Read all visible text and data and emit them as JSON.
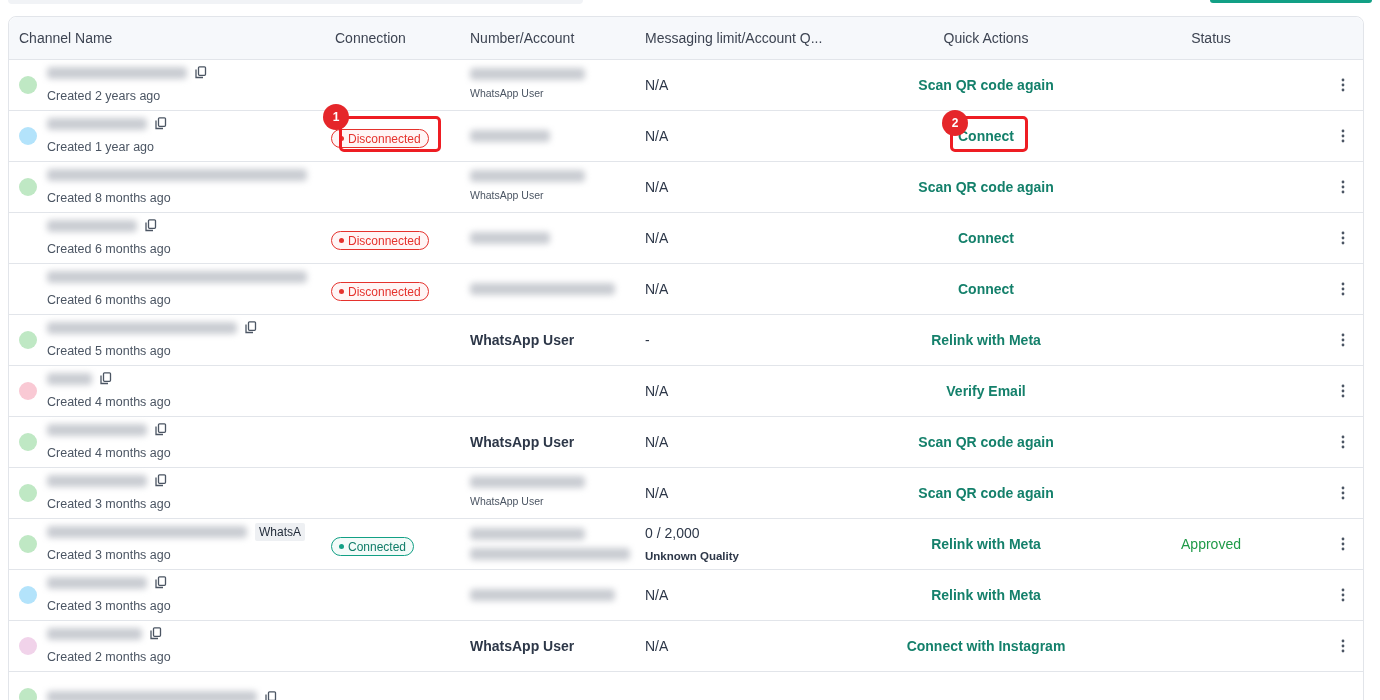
{
  "table": {
    "columns": [
      "Channel Name",
      "Connection",
      "Number/Account",
      "Messaging limit/Account Q...",
      "Quick Actions",
      "Status"
    ],
    "rows": [
      {
        "color": "#bfe8c4",
        "copy": true,
        "created": "Created 2 years ago",
        "connection": {
          "kind": "none"
        },
        "account": {
          "kind": "blurred_sub",
          "text": "WhatsApp User"
        },
        "limit": "N/A",
        "action": "Scan QR code again"
      },
      {
        "color": "#b3e3fb",
        "copy": true,
        "created": "Created 1 year ago",
        "connection": {
          "kind": "disconnected",
          "text": "Disconnected",
          "marker": "1"
        },
        "account": {
          "kind": "blurred"
        },
        "limit": "N/A",
        "action": "Connect",
        "action_marker": "2"
      },
      {
        "color": "#bfe8c4",
        "copy": false,
        "created": "Created 8 months ago",
        "connection": {
          "kind": "none"
        },
        "account": {
          "kind": "blurred_sub",
          "text": "WhatsApp User"
        },
        "limit": "N/A",
        "action": "Scan QR code again"
      },
      {
        "copy": true,
        "created": "Created 6 months ago",
        "connection": {
          "kind": "disconnected",
          "text": "Disconnected"
        },
        "account": {
          "kind": "blurred"
        },
        "limit": "N/A",
        "action": "Connect"
      },
      {
        "copy": false,
        "created": "Created 6 months ago",
        "connection": {
          "kind": "disconnected",
          "text": "Disconnected"
        },
        "account": {
          "kind": "blurred"
        },
        "limit": "N/A",
        "action": "Connect"
      },
      {
        "color": "#bfe8c4",
        "copy": true,
        "created": "Created 5 months ago",
        "connection": {
          "kind": "none"
        },
        "account": {
          "kind": "bold",
          "text": "WhatsApp User"
        },
        "limit": "-",
        "action": "Relink with Meta"
      },
      {
        "color": "#f9c9d4",
        "copy": true,
        "created": "Created 4 months ago",
        "connection": {
          "kind": "none"
        },
        "account": {
          "kind": "none"
        },
        "limit": "N/A",
        "action": "Verify Email"
      },
      {
        "color": "#bfe8c4",
        "copy": true,
        "created": "Created 4 months ago",
        "connection": {
          "kind": "none"
        },
        "account": {
          "kind": "bold",
          "text": "WhatsApp User"
        },
        "limit": "N/A",
        "action": "Scan QR code again"
      },
      {
        "color": "#bfe8c4",
        "copy": true,
        "created": "Created 3 months ago",
        "connection": {
          "kind": "none"
        },
        "account": {
          "kind": "blurred_sub",
          "text": "WhatsApp User"
        },
        "limit": "N/A",
        "action": "Scan QR code again"
      },
      {
        "color": "#bfe8c4",
        "copy": false,
        "tag": "WhatsA",
        "created": "Created 3 months ago",
        "connection": {
          "kind": "connected",
          "text": "Connected"
        },
        "account": {
          "kind": "blurred_two"
        },
        "limit": "0 / 2,000",
        "quality": "Unknown Quality",
        "action": "Relink with Meta",
        "status": "Approved"
      },
      {
        "color": "#b3e3fb",
        "copy": true,
        "created": "Created 3 months ago",
        "connection": {
          "kind": "none"
        },
        "account": {
          "kind": "blurred"
        },
        "limit": "N/A",
        "action": "Relink with Meta"
      },
      {
        "color": "#f1d3ea",
        "copy": true,
        "created": "Created 2 months ago",
        "connection": {
          "kind": "none"
        },
        "account": {
          "kind": "bold",
          "text": "WhatsApp User"
        },
        "limit": "N/A",
        "action": "Connect with Instagram"
      },
      {
        "color": "#bfe8c4",
        "copy": true,
        "connection": {
          "kind": "none"
        },
        "account": {
          "kind": "none"
        }
      }
    ]
  }
}
